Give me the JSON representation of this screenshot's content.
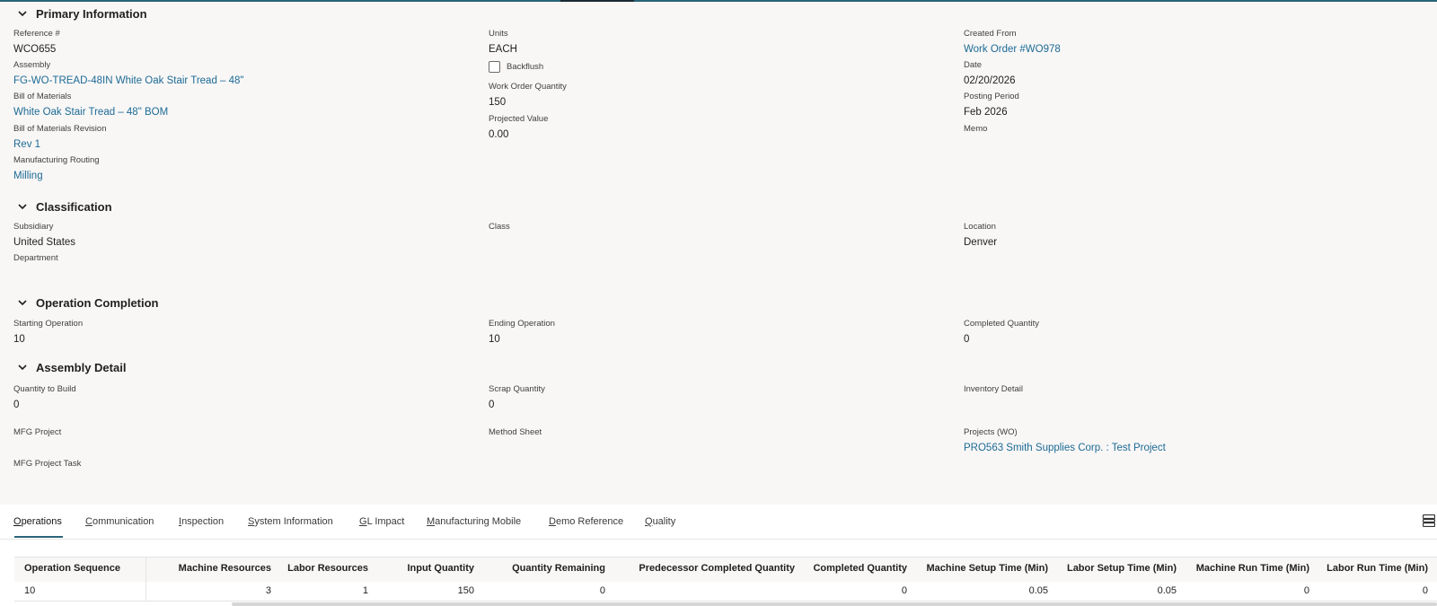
{
  "sections": {
    "primary": "Primary Information",
    "classification": "Classification",
    "operation": "Operation Completion",
    "assembly": "Assembly Detail"
  },
  "primary": {
    "reference": {
      "label": "Reference #",
      "value": "WCO655"
    },
    "assembly": {
      "label": "Assembly",
      "value": "FG-WO-TREAD-48IN White Oak Stair Tread – 48\""
    },
    "bom": {
      "label": "Bill of Materials",
      "value": "White Oak Stair Tread – 48\" BOM"
    },
    "bom_rev": {
      "label": "Bill of Materials Revision",
      "value": "Rev 1"
    },
    "routing": {
      "label": "Manufacturing Routing",
      "value": "Milling"
    },
    "units": {
      "label": "Units",
      "value": "EACH"
    },
    "backflush": {
      "label": "Backflush",
      "checked": false
    },
    "wo_qty": {
      "label": "Work Order Quantity",
      "value": "150"
    },
    "projected": {
      "label": "Projected Value",
      "value": "0.00"
    },
    "created_from": {
      "label": "Created From",
      "value": "Work Order #WO978"
    },
    "date": {
      "label": "Date",
      "value": "02/20/2026"
    },
    "period": {
      "label": "Posting Period",
      "value": "Feb 2026"
    },
    "memo": {
      "label": "Memo",
      "value": ""
    }
  },
  "classification": {
    "subsidiary": {
      "label": "Subsidiary",
      "value": "United States"
    },
    "department": {
      "label": "Department",
      "value": ""
    },
    "class": {
      "label": "Class",
      "value": ""
    },
    "location": {
      "label": "Location",
      "value": "Denver"
    }
  },
  "operation": {
    "start": {
      "label": "Starting Operation",
      "value": "10"
    },
    "end": {
      "label": "Ending Operation",
      "value": "10"
    },
    "completed": {
      "label": "Completed Quantity",
      "value": "0"
    }
  },
  "assembly": {
    "qty_build": {
      "label": "Quantity to Build",
      "value": "0"
    },
    "scrap": {
      "label": "Scrap Quantity",
      "value": "0"
    },
    "inventory": {
      "label": "Inventory Detail",
      "value": ""
    },
    "mfg_project": {
      "label": "MFG Project",
      "value": ""
    },
    "method_sheet": {
      "label": "Method Sheet",
      "value": ""
    },
    "projects_wo": {
      "label": "Projects (WO)",
      "value": "PRO563 Smith Supplies Corp. : Test Project"
    },
    "mfg_task": {
      "label": "MFG Project Task",
      "value": ""
    }
  },
  "tabs": [
    {
      "key": "O",
      "rest": "perations"
    },
    {
      "key": "C",
      "rest": "ommunication"
    },
    {
      "key": "I",
      "rest": "nspection"
    },
    {
      "key": "S",
      "rest": "ystem Information"
    },
    {
      "key": "G",
      "rest": "L Impact"
    },
    {
      "key": "M",
      "rest": "anufacturing Mobile"
    },
    {
      "key": "D",
      "rest": "emo Reference"
    },
    {
      "key": "Q",
      "rest": "uality"
    }
  ],
  "grid": {
    "columns": [
      "Operation Sequence",
      "Machine Resources",
      "Labor Resources",
      "Input Quantity",
      "Quantity Remaining",
      "Predecessor Completed Quantity",
      "Completed Quantity",
      "Machine Setup Time (Min)",
      "Labor Setup Time (Min)",
      "Machine Run Time (Min)",
      "Labor Run Time (Min)"
    ],
    "rows": [
      [
        "10",
        "3",
        "1",
        "150",
        "0",
        "",
        "0",
        "0.05",
        "0.05",
        "0",
        "0"
      ]
    ]
  },
  "colors": {
    "accent": "#2a6478",
    "link": "#1d6a95"
  }
}
